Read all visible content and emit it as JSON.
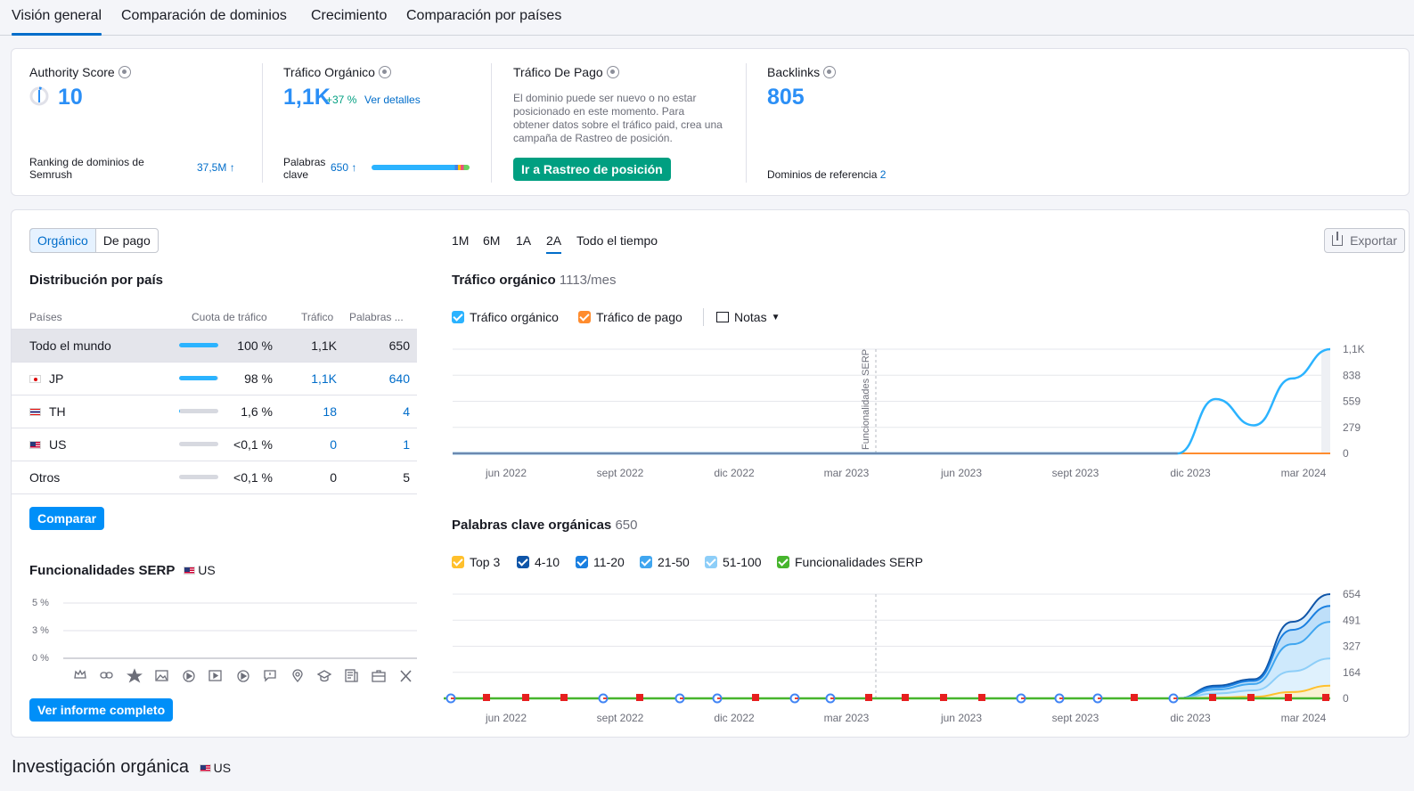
{
  "tabs": [
    "Visión general",
    "Comparación de dominios",
    "Crecimiento",
    "Comparación por países"
  ],
  "metrics": {
    "authority": {
      "title": "Authority Score",
      "value": "10",
      "ranking_label": "Ranking de dominios de Semrush",
      "ranking_value": "37,5M"
    },
    "organic": {
      "title": "Tráfico Orgánico",
      "value": "1,1K",
      "change": "+37 %",
      "details_link": "Ver detalles",
      "keywords_label": "Palabras clave",
      "keywords_value": "650"
    },
    "paid": {
      "title": "Tráfico De Pago",
      "note": "El dominio puede ser nuevo o no estar posicionado en este momento. Para obtener datos sobre el tráfico paid, crea una campaña de Rastreo de posición.",
      "button": "Ir a Rastreo de posición"
    },
    "backlinks": {
      "title": "Backlinks",
      "value": "805",
      "ref_label": "Dominios de referencia",
      "ref_value": "2"
    }
  },
  "left": {
    "toggle": [
      "Orgánico",
      "De pago"
    ],
    "distribution_title": "Distribución por país",
    "columns": [
      "Países",
      "Cuota de tráfico",
      "Tráfico",
      "Palabras ..."
    ],
    "rows": [
      {
        "country": "Todo el mundo",
        "flag": "",
        "share": "100 %",
        "share_pct": 100,
        "traffic": "1,1K",
        "keywords": "650",
        "link": false
      },
      {
        "country": "JP",
        "flag": "jp",
        "share": "98 %",
        "share_pct": 98,
        "traffic": "1,1K",
        "keywords": "640",
        "link": true
      },
      {
        "country": "TH",
        "flag": "th",
        "share": "1,6 %",
        "share_pct": 1.6,
        "traffic": "18",
        "keywords": "4",
        "link": true
      },
      {
        "country": "US",
        "flag": "us",
        "share": "<0,1 %",
        "share_pct": 0,
        "traffic": "0",
        "keywords": "1",
        "link": true
      },
      {
        "country": "Otros",
        "flag": "",
        "share": "<0,1 %",
        "share_pct": 0,
        "traffic": "0",
        "keywords": "5",
        "link": false
      }
    ],
    "compare_button": "Comparar",
    "serp_title": "Funcionalidades SERP",
    "serp_country": "US",
    "serp_y": [
      "5 %",
      "3 %",
      "0 %"
    ],
    "full_report_button": "Ver informe completo"
  },
  "right": {
    "periods": [
      "1M",
      "6M",
      "1A",
      "2A",
      "Todo el tiempo"
    ],
    "active_period": "2A",
    "export": "Exportar",
    "traffic_title": "Tráfico orgánico",
    "traffic_value": "1113/mes",
    "traffic_legend": [
      "Tráfico orgánico",
      "Tráfico de pago"
    ],
    "notes": "Notas",
    "serp_marker": "Funcionalidades SERP",
    "keywords_title": "Palabras clave orgánicas",
    "keywords_value": "650",
    "keywords_legend": [
      "Top 3",
      "4-10",
      "11-20",
      "21-50",
      "51-100",
      "Funcionalidades SERP"
    ],
    "legend_colors": [
      "#ffc02c",
      "#0f55a8",
      "#1a7fe0",
      "#40a6f0",
      "#8dcef8",
      "#47b52d"
    ]
  },
  "chart_data": [
    {
      "type": "line",
      "title": "Tráfico orgánico",
      "x": [
        "jun 2022",
        "sept 2022",
        "dic 2022",
        "mar 2023",
        "jun 2023",
        "sept 2023",
        "dic 2023",
        "mar 2024"
      ],
      "y_ticks": [
        "1,1K",
        "838",
        "559",
        "279",
        "0"
      ],
      "ylim": [
        0,
        1113
      ],
      "series": [
        {
          "name": "Tráfico orgánico",
          "color": "#2bb3ff",
          "values": [
            0,
            0,
            0,
            0,
            0,
            0,
            0,
            0,
            0,
            0,
            0,
            0,
            0,
            0,
            0,
            0,
            0,
            0,
            0,
            0,
            580,
            300,
            800,
            1113
          ]
        },
        {
          "name": "Tráfico de pago",
          "color": "#ff8c2e",
          "values": [
            0,
            0,
            0,
            0,
            0,
            0,
            0,
            0,
            0,
            0,
            0,
            0,
            0,
            0,
            0,
            0,
            0,
            0,
            0,
            0,
            0,
            0,
            0,
            0
          ]
        }
      ]
    },
    {
      "type": "area",
      "title": "Palabras clave orgánicas",
      "x": [
        "jun 2022",
        "sept 2022",
        "dic 2022",
        "mar 2023",
        "jun 2023",
        "sept 2023",
        "dic 2023",
        "mar 2024"
      ],
      "y_ticks": [
        "654",
        "491",
        "327",
        "164",
        "0"
      ],
      "ylim": [
        0,
        654
      ],
      "series": [
        {
          "name": "Top 3",
          "values": [
            0,
            0,
            0,
            0,
            0,
            0,
            0,
            0,
            0,
            0,
            0,
            0,
            0,
            0,
            0,
            0,
            0,
            0,
            0,
            0,
            5,
            10,
            40,
            80
          ]
        },
        {
          "name": "4-10",
          "values": [
            0,
            0,
            0,
            0,
            0,
            0,
            0,
            0,
            0,
            0,
            0,
            0,
            0,
            0,
            0,
            0,
            0,
            0,
            0,
            0,
            80,
            120,
            480,
            654
          ]
        },
        {
          "name": "11-20",
          "values": [
            0,
            0,
            0,
            0,
            0,
            0,
            0,
            0,
            0,
            0,
            0,
            0,
            0,
            0,
            0,
            0,
            0,
            0,
            0,
            0,
            70,
            110,
            430,
            580
          ]
        },
        {
          "name": "21-50",
          "values": [
            0,
            0,
            0,
            0,
            0,
            0,
            0,
            0,
            0,
            0,
            0,
            0,
            0,
            0,
            0,
            0,
            0,
            0,
            0,
            0,
            55,
            90,
            340,
            480
          ]
        },
        {
          "name": "51-100",
          "values": [
            0,
            0,
            0,
            0,
            0,
            0,
            0,
            0,
            0,
            0,
            0,
            0,
            0,
            0,
            0,
            0,
            0,
            0,
            0,
            0,
            30,
            50,
            170,
            250
          ]
        }
      ]
    }
  ],
  "section_bottom": {
    "title": "Investigación orgánica",
    "country": "US"
  }
}
